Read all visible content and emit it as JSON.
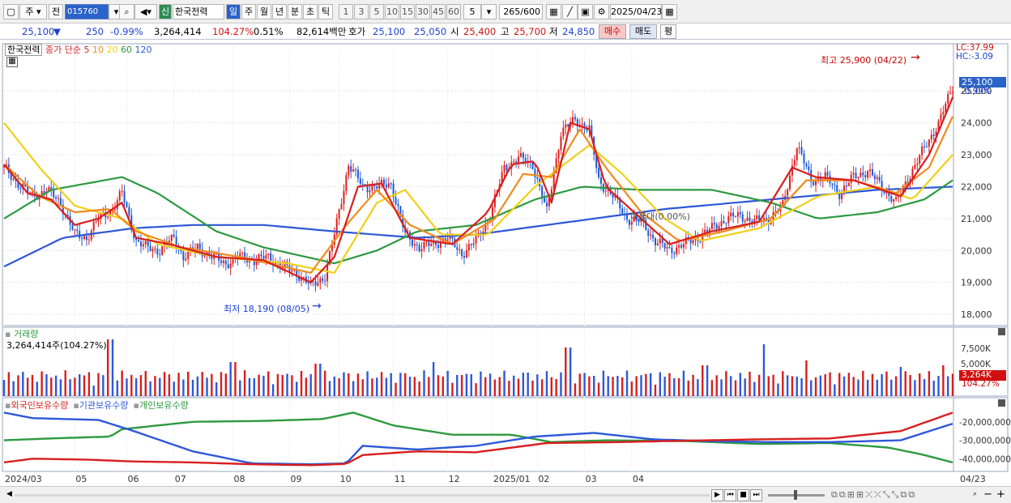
{
  "toolbar": {
    "view_combo": "주",
    "prev_label": "전",
    "code": "015760",
    "sin_badge": "신",
    "stock_name": "한국전력",
    "periods": [
      "일",
      "주",
      "월",
      "년",
      "분",
      "초",
      "틱"
    ],
    "active_period": "일",
    "minute_steps": [
      "1",
      "3",
      "5",
      "10",
      "15",
      "30",
      "45",
      "60"
    ],
    "step_value": "5",
    "count_value": "265",
    "count_total": "/600",
    "date_value": "2025/04/23"
  },
  "quote": {
    "price": "25,100",
    "change_arrow": "▼",
    "change": "250",
    "change_pct": "-0.99%",
    "volume": "3,264,414",
    "volume_ratio": "104.27%",
    "turnover": "0.51%",
    "amount": "82,614백만",
    "hoga_label": "호가",
    "ask": "25,100",
    "bid": "25,050",
    "open_label": "시",
    "open": "25,400",
    "high_label": "고",
    "high": "25,700",
    "low_label": "저",
    "low": "24,850",
    "buy_label": "매수",
    "sell_label": "매도",
    "flat_label": "평"
  },
  "legend": {
    "name": "한국전력",
    "series_label": "종가 단순",
    "ma_periods": [
      "5",
      "10",
      "20",
      "60",
      "120"
    ],
    "ma_colors": [
      "#d91e1e",
      "#f08a1c",
      "#f0d018",
      "#2d9a40",
      "#2d58d8"
    ]
  },
  "overlays": {
    "lc": "LC:37.99",
    "hc": "HC:-3.09",
    "max_label": "최고 25,900 (04/22)",
    "min_label": "최저 18,190 (08/05)",
    "gap_label": "매물대(0.00%)",
    "last_price": "25,100",
    "last_pct": "-0.99%",
    "vol_title": "거래량",
    "vol_value": "3,264,414주(104.27%)",
    "vol_last": "3,264K",
    "vol_last_pct": "104.27%",
    "holding_legend": [
      "외국인보유수량",
      "기관보유수량",
      "개인보유수량"
    ],
    "holding_colors": [
      "#d81e1e",
      "#2d58d8",
      "#2d9a40"
    ]
  },
  "chart_data": {
    "type": "candlestick",
    "price_axis": [
      "25,000",
      "24,000",
      "23,000",
      "22,000",
      "21,000",
      "20,000",
      "19,000",
      "18,000"
    ],
    "price_range": [
      17700,
      26400
    ],
    "volume_axis": [
      "7,500K",
      "5,000K"
    ],
    "holding_axis": [
      "-20,000,000",
      "-30,000,000",
      "-40,000,000"
    ],
    "date_axis": [
      "2024/03",
      "05",
      "06",
      "07",
      "08",
      "09",
      "10",
      "11",
      "12",
      "2025/01",
      "02",
      "03",
      "04",
      "04/23"
    ],
    "close_path": [
      [
        0,
        22600
      ],
      [
        6,
        22100
      ],
      [
        12,
        21700
      ],
      [
        18,
        21900
      ],
      [
        24,
        21500
      ],
      [
        30,
        20500
      ],
      [
        35,
        20400
      ],
      [
        40,
        21000
      ],
      [
        46,
        21300
      ],
      [
        50,
        21800
      ],
      [
        56,
        20300
      ],
      [
        60,
        20100
      ],
      [
        66,
        20000
      ],
      [
        72,
        20400
      ],
      [
        76,
        19800
      ],
      [
        82,
        20100
      ],
      [
        88,
        19800
      ],
      [
        94,
        19600
      ],
      [
        100,
        19800
      ],
      [
        106,
        19700
      ],
      [
        112,
        19800
      ],
      [
        118,
        19500
      ],
      [
        124,
        19300
      ],
      [
        130,
        18900
      ],
      [
        136,
        19200
      ],
      [
        140,
        20500
      ],
      [
        146,
        22700
      ],
      [
        152,
        22000
      ],
      [
        158,
        22000
      ],
      [
        164,
        22100
      ],
      [
        170,
        20500
      ],
      [
        176,
        20100
      ],
      [
        182,
        20200
      ],
      [
        188,
        20400
      ],
      [
        194,
        19900
      ],
      [
        200,
        20300
      ],
      [
        206,
        21100
      ],
      [
        212,
        22600
      ],
      [
        218,
        22900
      ],
      [
        224,
        22700
      ],
      [
        230,
        21200
      ],
      [
        236,
        23700
      ],
      [
        242,
        24100
      ],
      [
        248,
        23800
      ],
      [
        252,
        22200
      ],
      [
        258,
        21700
      ],
      [
        264,
        21000
      ],
      [
        270,
        20900
      ],
      [
        276,
        20300
      ],
      [
        282,
        20000
      ],
      [
        288,
        20200
      ],
      [
        294,
        20400
      ],
      [
        300,
        20700
      ],
      [
        306,
        21000
      ],
      [
        312,
        21100
      ],
      [
        318,
        20900
      ],
      [
        324,
        21000
      ],
      [
        330,
        21400
      ],
      [
        336,
        23300
      ],
      [
        342,
        22200
      ],
      [
        348,
        22300
      ],
      [
        354,
        21800
      ],
      [
        360,
        22300
      ],
      [
        366,
        22500
      ],
      [
        372,
        22000
      ],
      [
        378,
        21500
      ],
      [
        384,
        22400
      ],
      [
        390,
        23200
      ],
      [
        396,
        24000
      ],
      [
        402,
        25100
      ]
    ],
    "moving_averages": {
      "ma5": [
        [
          0,
          22700
        ],
        [
          10,
          21800
        ],
        [
          20,
          21600
        ],
        [
          30,
          20800
        ],
        [
          40,
          21000
        ],
        [
          50,
          21500
        ],
        [
          56,
          20400
        ],
        [
          70,
          20200
        ],
        [
          90,
          19800
        ],
        [
          110,
          19700
        ],
        [
          130,
          19000
        ],
        [
          140,
          19800
        ],
        [
          150,
          22000
        ],
        [
          160,
          22100
        ],
        [
          172,
          20400
        ],
        [
          190,
          20200
        ],
        [
          205,
          21200
        ],
        [
          215,
          22700
        ],
        [
          225,
          22800
        ],
        [
          232,
          21500
        ],
        [
          240,
          24000
        ],
        [
          248,
          23800
        ],
        [
          255,
          22000
        ],
        [
          270,
          21000
        ],
        [
          282,
          20200
        ],
        [
          300,
          20600
        ],
        [
          320,
          20900
        ],
        [
          334,
          22600
        ],
        [
          344,
          22300
        ],
        [
          360,
          22200
        ],
        [
          372,
          21900
        ],
        [
          380,
          21700
        ],
        [
          392,
          23000
        ],
        [
          402,
          24800
        ]
      ],
      "ma10": [
        [
          0,
          22700
        ],
        [
          15,
          21700
        ],
        [
          30,
          21200
        ],
        [
          45,
          21300
        ],
        [
          56,
          20600
        ],
        [
          75,
          20100
        ],
        [
          100,
          19800
        ],
        [
          130,
          19300
        ],
        [
          145,
          20800
        ],
        [
          158,
          21900
        ],
        [
          172,
          20800
        ],
        [
          190,
          20200
        ],
        [
          208,
          21000
        ],
        [
          220,
          22400
        ],
        [
          232,
          22300
        ],
        [
          244,
          23800
        ],
        [
          255,
          22600
        ],
        [
          270,
          21200
        ],
        [
          286,
          20300
        ],
        [
          305,
          20600
        ],
        [
          325,
          21000
        ],
        [
          340,
          22200
        ],
        [
          360,
          22200
        ],
        [
          378,
          21800
        ],
        [
          392,
          22600
        ],
        [
          402,
          24200
        ]
      ],
      "ma20": [
        [
          0,
          24000
        ],
        [
          15,
          22600
        ],
        [
          30,
          21400
        ],
        [
          50,
          21000
        ],
        [
          65,
          20200
        ],
        [
          90,
          19800
        ],
        [
          120,
          19600
        ],
        [
          140,
          19300
        ],
        [
          158,
          21500
        ],
        [
          170,
          21900
        ],
        [
          185,
          20500
        ],
        [
          205,
          20500
        ],
        [
          225,
          22000
        ],
        [
          248,
          23300
        ],
        [
          262,
          22400
        ],
        [
          280,
          21000
        ],
        [
          295,
          20300
        ],
        [
          320,
          20700
        ],
        [
          345,
          21700
        ],
        [
          370,
          22000
        ],
        [
          385,
          21600
        ],
        [
          402,
          23000
        ]
      ],
      "ma60": [
        [
          0,
          21000
        ],
        [
          20,
          21900
        ],
        [
          50,
          22300
        ],
        [
          65,
          21800
        ],
        [
          90,
          20600
        ],
        [
          110,
          20100
        ],
        [
          140,
          19600
        ],
        [
          158,
          20000
        ],
        [
          175,
          20600
        ],
        [
          200,
          20800
        ],
        [
          225,
          21600
        ],
        [
          245,
          22000
        ],
        [
          270,
          21900
        ],
        [
          300,
          21900
        ],
        [
          325,
          21500
        ],
        [
          345,
          21000
        ],
        [
          370,
          21200
        ],
        [
          390,
          21600
        ],
        [
          402,
          22200
        ]
      ],
      "ma120": [
        [
          0,
          19500
        ],
        [
          25,
          20400
        ],
        [
          55,
          20700
        ],
        [
          80,
          20800
        ],
        [
          110,
          20800
        ],
        [
          140,
          20600
        ],
        [
          175,
          20400
        ],
        [
          200,
          20500
        ],
        [
          230,
          20800
        ],
        [
          250,
          21000
        ],
        [
          280,
          21300
        ],
        [
          310,
          21500
        ],
        [
          340,
          21700
        ],
        [
          370,
          21900
        ],
        [
          402,
          22000
        ]
      ]
    },
    "holdings": {
      "foreign": [
        [
          0,
          -42000000
        ],
        [
          12,
          -40000000
        ],
        [
          35,
          -40500000
        ],
        [
          55,
          -41500000
        ],
        [
          80,
          -42000000
        ],
        [
          105,
          -43000000
        ],
        [
          130,
          -43500000
        ],
        [
          145,
          -42800000
        ],
        [
          152,
          -38000000
        ],
        [
          175,
          -36000000
        ],
        [
          200,
          -36500000
        ],
        [
          230,
          -31500000
        ],
        [
          260,
          -31000000
        ],
        [
          290,
          -30200000
        ],
        [
          320,
          -29500000
        ],
        [
          350,
          -29000000
        ],
        [
          380,
          -25000000
        ],
        [
          402,
          -15000000
        ]
      ],
      "institution": [
        [
          0,
          -15000000
        ],
        [
          12,
          -18000000
        ],
        [
          40,
          -19000000
        ],
        [
          55,
          -25000000
        ],
        [
          80,
          -36000000
        ],
        [
          105,
          -42500000
        ],
        [
          130,
          -43000000
        ],
        [
          145,
          -42500000
        ],
        [
          152,
          -33000000
        ],
        [
          175,
          -35000000
        ],
        [
          200,
          -33000000
        ],
        [
          225,
          -28000000
        ],
        [
          250,
          -26000000
        ],
        [
          275,
          -29500000
        ],
        [
          300,
          -30500000
        ],
        [
          325,
          -31000000
        ],
        [
          350,
          -31000000
        ],
        [
          380,
          -30000000
        ],
        [
          402,
          -21000000
        ]
      ],
      "individual": [
        [
          0,
          -30000000
        ],
        [
          20,
          -29000000
        ],
        [
          45,
          -28000000
        ],
        [
          50,
          -24000000
        ],
        [
          80,
          -20000000
        ],
        [
          110,
          -19500000
        ],
        [
          135,
          -18500000
        ],
        [
          148,
          -15000000
        ],
        [
          165,
          -22000000
        ],
        [
          190,
          -27000000
        ],
        [
          215,
          -27000000
        ],
        [
          232,
          -31000000
        ],
        [
          255,
          -30000000
        ],
        [
          290,
          -30500000
        ],
        [
          320,
          -32000000
        ],
        [
          350,
          -31500000
        ],
        [
          375,
          -34000000
        ],
        [
          390,
          -38000000
        ],
        [
          402,
          -42000000
        ]
      ]
    }
  },
  "bottombar": {
    "icons": [
      "play-icon",
      "first-icon",
      "stop-icon",
      "last-icon",
      "zoom-out-icon",
      "plus-icon"
    ]
  }
}
